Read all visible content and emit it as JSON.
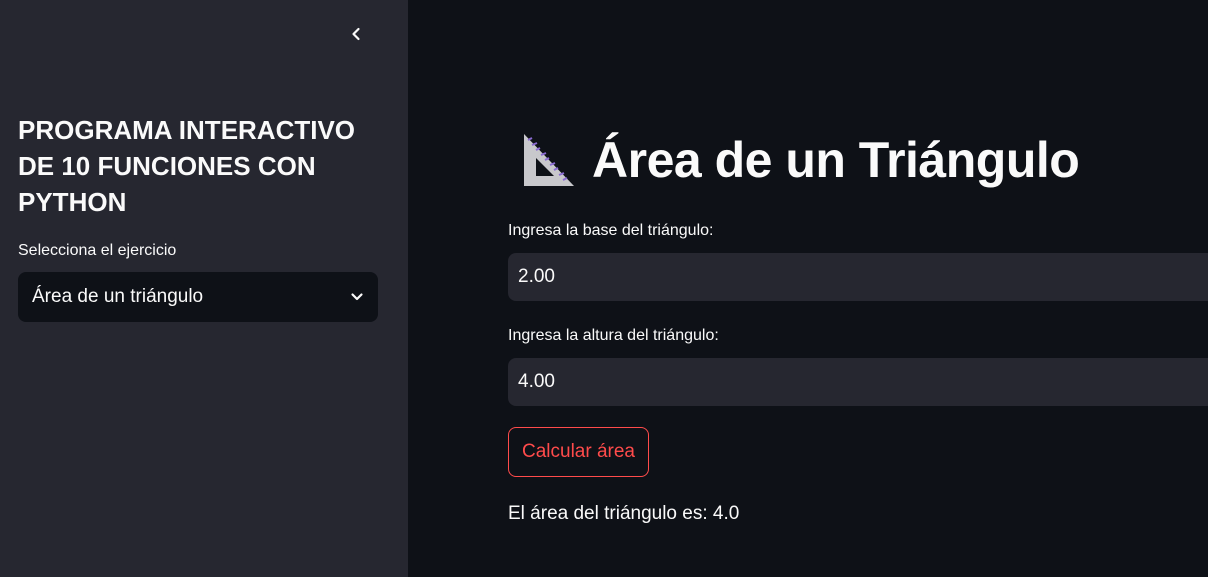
{
  "sidebar": {
    "title": "PROGRAMA INTERACTIVO\nDE 10 FUNCIONES CON\nPYTHON",
    "select_label": "Selecciona el ejercicio",
    "select_value": "Área de un triángulo",
    "collapse_icon": "chevron-left-icon",
    "dropdown_icon": "chevron-down-icon"
  },
  "main": {
    "heading_icon": "triangular-ruler-icon",
    "heading": "Área de un Triángulo",
    "base_label": "Ingresa la base del triángulo:",
    "base_value": "2.00",
    "height_label": "Ingresa la altura del triángulo:",
    "height_value": "4.00",
    "button_label": "Calcular área",
    "result_text": "El área del triángulo es: 4.0"
  },
  "colors": {
    "sidebar_bg": "#262730",
    "main_bg": "#0e1117",
    "input_bg": "#262730",
    "accent": "#ff4b4b",
    "text": "#fafafa"
  }
}
